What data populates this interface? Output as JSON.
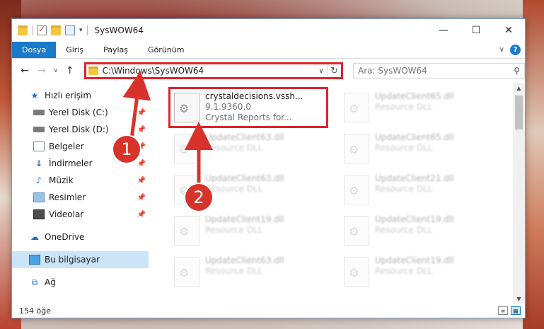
{
  "window": {
    "title": "SysWOW64",
    "controls": {
      "minimize": "—",
      "maximize": "☐",
      "close": "✕"
    }
  },
  "ribbon": {
    "tabs": [
      "Dosya",
      "Giriş",
      "Paylaş",
      "Görünüm"
    ]
  },
  "navbar": {
    "back": "←",
    "forward": "→",
    "recent": "∨",
    "up": "↑",
    "address": "C:\\Windows\\SysWOW64",
    "refresh": "↻",
    "search_placeholder": "Ara: SysWOW64",
    "search_icon": "⚲"
  },
  "nav_pane": {
    "quick_access": "Hızlı erişim",
    "items": [
      {
        "label": "Yerel Disk (C:)",
        "icon": "disk-icon"
      },
      {
        "label": "Yerel Disk (D:)",
        "icon": "disk-icon"
      },
      {
        "label": "Belgeler",
        "icon": "documents-icon"
      },
      {
        "label": "İndirmeler",
        "icon": "download-icon"
      },
      {
        "label": "Müzik",
        "icon": "music-icon"
      },
      {
        "label": "Resimler",
        "icon": "pictures-icon"
      },
      {
        "label": "Videolar",
        "icon": "videos-icon"
      }
    ],
    "onedrive": "OneDrive",
    "this_pc": "Bu bilgisayar",
    "network": "Ağ"
  },
  "files": {
    "highlighted": {
      "name": "crystaldecisions.vssh...",
      "version": "9.1.9360.0",
      "description": "Crystal Reports for..."
    },
    "column1": [
      {
        "name": "UpdateClient63.dll",
        "type": "Resource DLL"
      },
      {
        "name": "UpdateClient63.dll",
        "type": "Resource DLL"
      },
      {
        "name": "UpdateClient19.dll",
        "type": "Resource DLL"
      },
      {
        "name": "UpdateClient63.dll",
        "type": "Resource DLL"
      }
    ],
    "column2": [
      {
        "name": "UpdateClient65.dll",
        "type": "Resource DLL"
      },
      {
        "name": "UpdateClient65.dll",
        "type": "Resource DLL"
      },
      {
        "name": "UpdateClient21.dll",
        "type": "Resource DLL"
      },
      {
        "name": "UpdateClient19.dll",
        "type": "Resource DLL"
      },
      {
        "name": "UpdateClient19.dll",
        "type": "Resource DLL"
      }
    ]
  },
  "status": {
    "count": "154 öğe"
  },
  "callouts": {
    "one": "1",
    "two": "2"
  },
  "colors": {
    "highlight": "#e0222a",
    "callout": "#d8332a",
    "file_tab": "#1979ca"
  }
}
